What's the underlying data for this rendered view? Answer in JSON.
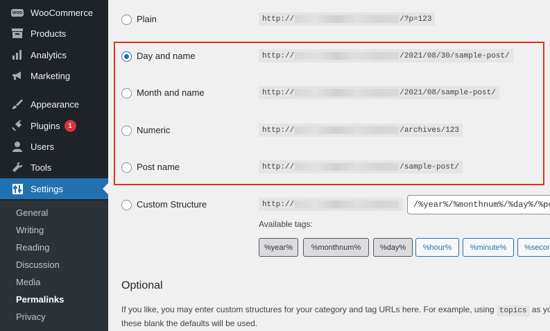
{
  "sidebar": {
    "items": [
      {
        "label": "WooCommerce",
        "icon": "woo",
        "badge": ""
      },
      {
        "label": "Products",
        "icon": "box",
        "badge": ""
      },
      {
        "label": "Analytics",
        "icon": "chart",
        "badge": ""
      },
      {
        "label": "Marketing",
        "icon": "megaphone",
        "badge": ""
      },
      {
        "label": "Appearance",
        "icon": "brush",
        "badge": ""
      },
      {
        "label": "Plugins",
        "icon": "plug",
        "badge": "1"
      },
      {
        "label": "Users",
        "icon": "user",
        "badge": ""
      },
      {
        "label": "Tools",
        "icon": "wrench",
        "badge": ""
      },
      {
        "label": "Settings",
        "icon": "sliders",
        "badge": ""
      }
    ],
    "woo_icon_text": "woo",
    "submenu": [
      "General",
      "Writing",
      "Reading",
      "Discussion",
      "Media",
      "Permalinks",
      "Privacy"
    ]
  },
  "permalinks": {
    "options": [
      {
        "label": "Plain",
        "prefix": "http://",
        "suffix": "/?p=123",
        "checked": false
      },
      {
        "label": "Day and name",
        "prefix": "http://",
        "suffix": "/2021/08/30/sample-post/",
        "checked": true
      },
      {
        "label": "Month and name",
        "prefix": "http://",
        "suffix": "/2021/08/sample-post/",
        "checked": false
      },
      {
        "label": "Numeric",
        "prefix": "http://",
        "suffix": "/archives/123",
        "checked": false
      },
      {
        "label": "Post name",
        "prefix": "http://",
        "suffix": "/sample-post/",
        "checked": false
      }
    ],
    "custom": {
      "label": "Custom Structure",
      "prefix": "http://",
      "value": "/%year%/%monthnum%/%day%/%pos"
    },
    "tags_label": "Available tags:",
    "tags": [
      "%year%",
      "%monthnum%",
      "%day%",
      "%hour%",
      "%minute%",
      "%secor"
    ]
  },
  "optional": {
    "title": "Optional",
    "desc_before": "If you like, you may enter custom structures for your category and tag URLs here. For example, using",
    "desc_code": "topics",
    "desc_after": "as your c",
    "desc_line2": "these blank the defaults will be used."
  },
  "colors": {
    "accent": "#2271b1",
    "sidebar_bg": "#1d2327",
    "highlight_border": "#e2311e",
    "badge": "#d63638"
  }
}
